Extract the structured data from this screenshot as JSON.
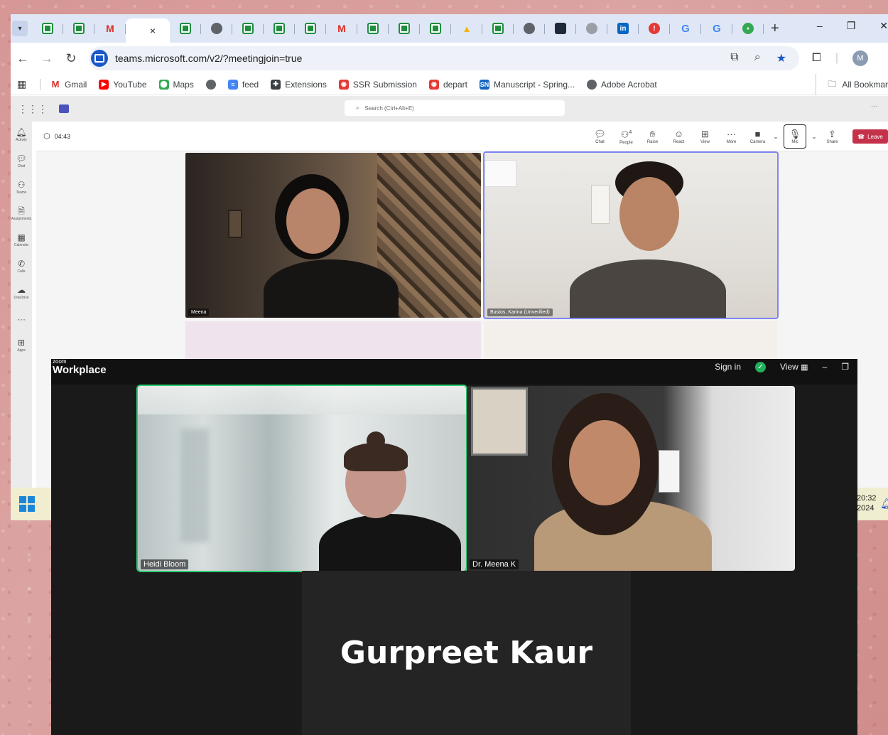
{
  "browser": {
    "tabs": [
      {
        "icon": "sheets-icon"
      },
      {
        "icon": "sheets-icon"
      },
      {
        "icon": "gmail-icon"
      },
      {
        "icon": "teams-tab",
        "active": true,
        "close": "×"
      },
      {
        "icon": "sheets-icon"
      },
      {
        "icon": "globe-icon"
      },
      {
        "icon": "sheets-icon"
      },
      {
        "icon": "sheets-icon"
      },
      {
        "icon": "sheets-icon"
      },
      {
        "icon": "gmail-icon"
      },
      {
        "icon": "sheets-icon"
      },
      {
        "icon": "sheets-icon"
      },
      {
        "icon": "sheets-icon"
      },
      {
        "icon": "drive-icon"
      },
      {
        "icon": "sheets-icon"
      },
      {
        "icon": "globe-icon"
      },
      {
        "icon": "dark-icon"
      },
      {
        "icon": "grey-icon"
      },
      {
        "icon": "linkedin-icon"
      },
      {
        "icon": "alert-icon"
      },
      {
        "icon": "google-icon"
      },
      {
        "icon": "google-icon"
      },
      {
        "icon": "green-icon"
      }
    ],
    "new_tab": "+",
    "window": {
      "minimize": "–",
      "restore": "❐",
      "close": "✕"
    },
    "url": "teams.microsoft.com/v2/?meetingjoin=true",
    "profile_initial": "M",
    "bookmarks": [
      {
        "label": "Gmail",
        "icon": "gmail-icon",
        "color": "#d93025"
      },
      {
        "label": "YouTube",
        "icon": "youtube-icon",
        "color": "#ff0000"
      },
      {
        "label": "Maps",
        "icon": "maps-icon",
        "color": "#34a853"
      },
      {
        "label": "",
        "icon": "globe-icon",
        "color": "#5f6368"
      },
      {
        "label": "feed",
        "icon": "docs-icon",
        "color": "#4285f4"
      },
      {
        "label": "Extensions",
        "icon": "puzzle-icon",
        "color": "#3c4043"
      },
      {
        "label": "SSR Submission",
        "icon": "ssr-icon",
        "color": "#e53935"
      },
      {
        "label": "depart",
        "icon": "ssr-icon",
        "color": "#e53935"
      },
      {
        "label": "Manuscript - Spring...",
        "icon": "sn-icon",
        "color": "#1565c0"
      },
      {
        "label": "Adobe Acrobat",
        "icon": "globe-icon",
        "color": "#5f6368"
      }
    ],
    "all_bookmarks": "All Bookmar"
  },
  "teams": {
    "search_placeholder": "Search (Ctrl+Alt+E)",
    "rail": [
      "Activity",
      "Chat",
      "Teams",
      "Assignments",
      "Calendar",
      "Calls",
      "OneDrive",
      "",
      "Apps"
    ],
    "timer": "04:43",
    "controls": [
      "Chat",
      "People",
      "Raise",
      "React",
      "View",
      "More",
      "Camera",
      "Mic",
      "Share"
    ],
    "people_count": "4",
    "leave": "Leave",
    "participants": [
      {
        "name": "Meena"
      },
      {
        "name": "Bustos, Karina (Unverified)"
      }
    ]
  },
  "taskbar": {
    "time": "20:32",
    "date": "2024"
  },
  "zoom": {
    "brand_top": "zoom",
    "brand": "Workplace",
    "sign_in": "Sign in",
    "view": "View",
    "participants": [
      {
        "name": "Heidi Bloom"
      },
      {
        "name": "Dr. Meena K"
      }
    ],
    "no_video_name": "Gurpreet Kaur"
  }
}
